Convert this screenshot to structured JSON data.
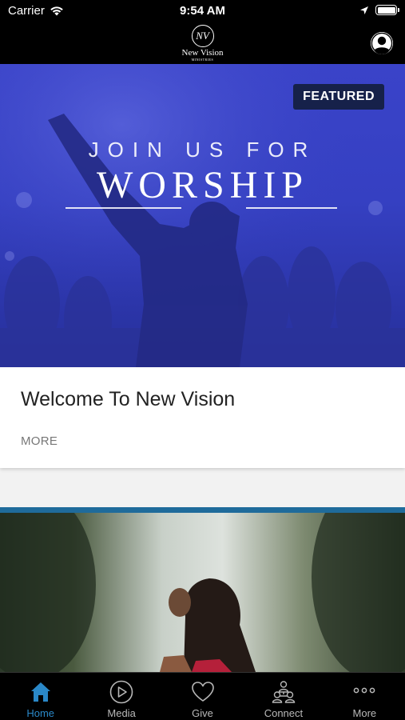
{
  "status": {
    "carrier": "Carrier",
    "time": "9:54 AM"
  },
  "header": {
    "logo_monogram": "NV",
    "logo_name": "New Vision",
    "logo_sub": "MINISTRIES"
  },
  "featured": {
    "badge": "FEATURED",
    "hero_line1": "JOIN US FOR",
    "hero_line2": "WORSHIP",
    "title": "Welcome To New Vision",
    "more": "MORE"
  },
  "tabs": [
    {
      "label": "Home",
      "icon": "home-icon",
      "active": true
    },
    {
      "label": "Media",
      "icon": "play-icon",
      "active": false
    },
    {
      "label": "Give",
      "icon": "heart-icon",
      "active": false
    },
    {
      "label": "Connect",
      "icon": "people-icon",
      "active": false
    },
    {
      "label": "More",
      "icon": "more-icon",
      "active": false
    }
  ],
  "colors": {
    "accent": "#2a88c8",
    "hero_blue": "#3540c2",
    "badge_bg": "#16214a",
    "stripe": "#1f6b9b"
  }
}
